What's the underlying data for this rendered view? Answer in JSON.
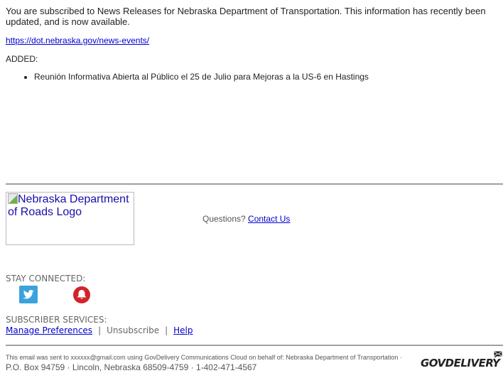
{
  "intro_text": "You are subscribed to News Releases for Nebraska Department of Transportation. This information has recently been updated, and is now available.",
  "link_url": "https://dot.nebraska.gov/news-events/",
  "added_label": "ADDED:",
  "added_items": [
    "Reunión Informativa Abierta al Público el 25 de Julio para Mejoras a la US-6 en Hastings"
  ],
  "logo_alt": "Nebraska Department of Roads Logo",
  "questions_label": "Questions?",
  "contact_label": "Contact Us",
  "stay_connected_label": "STAY CONNECTED:",
  "social_icons": [
    "twitter-icon",
    "alert-bell-icon"
  ],
  "subscriber_services_label": "SUBSCRIBER SERVICES:",
  "subscriber_links": {
    "manage": "Manage Preferences",
    "separator": "|",
    "unsubscribe": "Unsubscribe",
    "help": "Help"
  },
  "legal": {
    "sent_to": "This email was sent to xxxxxx@gmail.com using GovDelivery Communications Cloud on behalf of: Nebraska Department of Transportation ·",
    "address": "P.O. Box 94759 · Lincoln, Nebraska 68509-4759 · 1-402-471-4567"
  },
  "brand_logo": "GOVDELIVERY",
  "colors": {
    "link": "#0000cc",
    "twitter": "#3aa3dc",
    "alert": "#d2232a"
  }
}
